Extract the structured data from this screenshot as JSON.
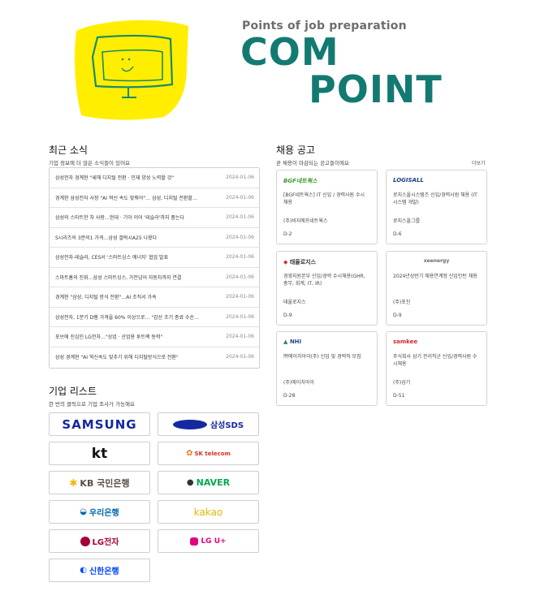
{
  "header": {
    "tagline": "Points of job preparation",
    "brand_line1": "COM",
    "brand_line2": "POINT"
  },
  "news": {
    "title": "최근 소식",
    "subtitle": "기업 정보에 더 많은 소식들이 있어요",
    "items": [
      {
        "title": "삼성전자 경계현 \"새해 디지털 전환 · 인재 양성 노력할 것\"",
        "date": "2024-01-06"
      },
      {
        "title": "경계현 삼성전자 사장 \"AI 혁신 속도 맞춰야\"… 삼성, 디지털 전환할…",
        "date": "2024-01-06"
      },
      {
        "title": "삼성의 스마트한 차 사랑…현대 · 기아 이어 '테슬라'까지 품는다",
        "date": "2024-01-06"
      },
      {
        "title": "S시리즈의 3분의1 가격…삼성 갤럭시A25 나왔다",
        "date": "2024-01-06"
      },
      {
        "title": "삼성전자-테슬라, CES서 '스마트싱스 에너지' 협업 발표",
        "date": "2024-01-06"
      },
      {
        "title": "스마트홈의 진화…삼성 스마트싱스, 가전넘어 자동차까지 연결",
        "date": "2024-01-06"
      },
      {
        "title": "경계현 \"삼성, 디지털 방식 전환\"…AI 조직서 가속",
        "date": "2024-01-06"
      },
      {
        "title": "삼성전자, 1분기 D램 가격을 60% 이상으로… \"감산 조기 종료 수순…",
        "date": "2024-01-06"
      },
      {
        "title": "포브에 진심인 LG전자…\"상업 · 산업용 투트랙 동력\"",
        "date": "2024-01-06"
      },
      {
        "title": "삼성 경계현 \"AI 혁신속도 맞추기 위해 디지털방식으로 전환\"",
        "date": "2024-01-06"
      }
    ]
  },
  "jobs": {
    "title": "채용 공고",
    "subtitle": "곧 채용이 마감되는 공고들이에요",
    "more": "더보기",
    "cards": [
      {
        "logo": "BGF네트웍스",
        "title": "[BGF네트웍스] IT 신입 / 경력사원 수시 채용",
        "company": "(주)비지에프네트웍스",
        "dday": "D-2",
        "color": "#3a9a2a"
      },
      {
        "logo": "LOGISALL",
        "title": "로지스올시스템즈 신입/경력사원 채용 (IT시스템 개발)",
        "company": "로지스올그룹",
        "dday": "D-6",
        "color": "#1a3a8a"
      },
      {
        "logo": "태울로지스",
        "title": "경영지원본부 신입/경력 수시채용(GHR, 총무, 회계, IT, IR)",
        "company": "태울로지스",
        "dday": "D-9",
        "color": "#d03030"
      },
      {
        "logo": "xeenergy",
        "title": "2024년상반기 채용연계형 신입인턴 채용",
        "company": "(주)포진",
        "dday": "D-9",
        "color": "#6a6a6a"
      },
      {
        "logo": "NHI",
        "title": "㈜에이치아이(주) 신입 및 경력직 모집",
        "company": "(주)에이치아이",
        "dday": "D-28",
        "color": "#2a8a4a"
      },
      {
        "logo": "samkee",
        "title": "주식회사 삼기 관리직군 신입/경력사원 수시채용",
        "company": "(주)삼기",
        "dday": "D-51",
        "color": "#d02a2a"
      }
    ]
  },
  "companies": {
    "title": "기업 리스트",
    "subtitle": "한 번의 클릭으로 기업 조사가 가능해요",
    "items": [
      {
        "name": "SAMSUNG",
        "color": "#1428a0"
      },
      {
        "name": "삼성SDS",
        "color": "#1428a0"
      },
      {
        "name": "kt",
        "color": "#111111"
      },
      {
        "name": "SK telecom",
        "color": "#e0301e"
      },
      {
        "name": "KB 국민은행",
        "color": "#5a5048"
      },
      {
        "name": "NAVER",
        "color": "#03a94f"
      },
      {
        "name": "우리은행",
        "color": "#0067ac"
      },
      {
        "name": "kakao",
        "color": "#e6b800"
      },
      {
        "name": "LG전자",
        "color": "#a50034"
      },
      {
        "name": "LG U+",
        "color": "#e6007e"
      },
      {
        "name": "신한은행",
        "color": "#0046ff"
      }
    ]
  }
}
